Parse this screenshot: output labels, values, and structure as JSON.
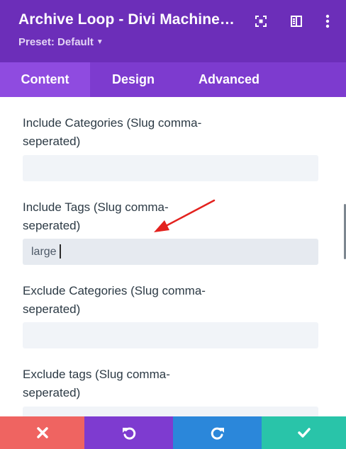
{
  "header": {
    "title": "Archive Loop - Divi Machine Module Settings",
    "preset_label": "Preset: Default"
  },
  "header_icons": [
    "focus-icon",
    "sidebar-layout-icon",
    "more-options-icon"
  ],
  "tabs": [
    {
      "label": "Content",
      "active": true
    },
    {
      "label": "Design",
      "active": false
    },
    {
      "label": "Advanced",
      "active": false
    }
  ],
  "fields": [
    {
      "label": "Include Categories (Slug comma-seperated)",
      "value": "",
      "placeholder": ""
    },
    {
      "label": "Include Tags (Slug comma-seperated)",
      "value": "large",
      "placeholder": ""
    },
    {
      "label": "Exclude Categories (Slug comma-seperated)",
      "value": "",
      "placeholder": ""
    },
    {
      "label": "Exclude tags (Slug comma-seperated)",
      "value": "",
      "placeholder": ""
    }
  ],
  "annotation": {
    "type": "red-arrow",
    "color": "#e3221e",
    "points_to": "Include Tags (Slug comma-seperated)"
  },
  "footer_buttons": [
    {
      "action": "discard",
      "icon": "close-icon",
      "color": "#ef6461"
    },
    {
      "action": "undo",
      "icon": "undo-icon",
      "color": "#7e3bd0"
    },
    {
      "action": "redo",
      "icon": "redo-icon",
      "color": "#2b87da"
    },
    {
      "action": "save",
      "icon": "check-icon",
      "color": "#29c4a9"
    }
  ],
  "colors": {
    "header_bg": "#6c2eb9",
    "tabs_bg": "#7d3bcf",
    "active_tab_bg": "#8f4be0",
    "input_bg": "#f1f4f8",
    "label_text": "#2c3a45"
  }
}
